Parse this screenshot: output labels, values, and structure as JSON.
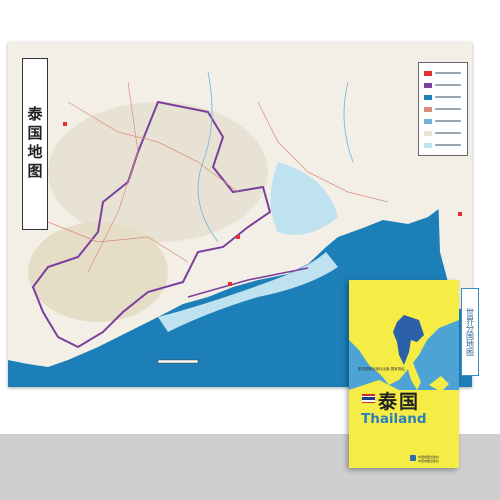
{
  "map_sheet": {
    "vertical_title": "泰国地图",
    "colors": {
      "sea": "#1d7fb7",
      "land": "#f3efe6",
      "shallow_sea": "#bfe2f1",
      "border": "#7b3f9e",
      "accent_red": "#e0322b"
    }
  },
  "cover": {
    "series_label": "世界分国地图",
    "publisher_line": "图书国家出版社出版 国家测绘",
    "title_cn": "泰国",
    "title_en": "Thailand",
    "publisher_foot_line1": "中国地图出版社",
    "publisher_foot_line2": "中国地图出版社",
    "colors": {
      "cover_yellow": "#f5ec45",
      "map_blue": "#4da3d6",
      "map_land": "#f5ec45",
      "highlight_country": "#2b5fa8",
      "title_en": "#2b7fbf",
      "flag_red": "#d8262e",
      "flag_white": "#ffffff",
      "flag_blue": "#1f3c8c"
    }
  },
  "background": {
    "colors": {
      "wall": "#ffffff",
      "floor": "#cfcfcf"
    }
  }
}
